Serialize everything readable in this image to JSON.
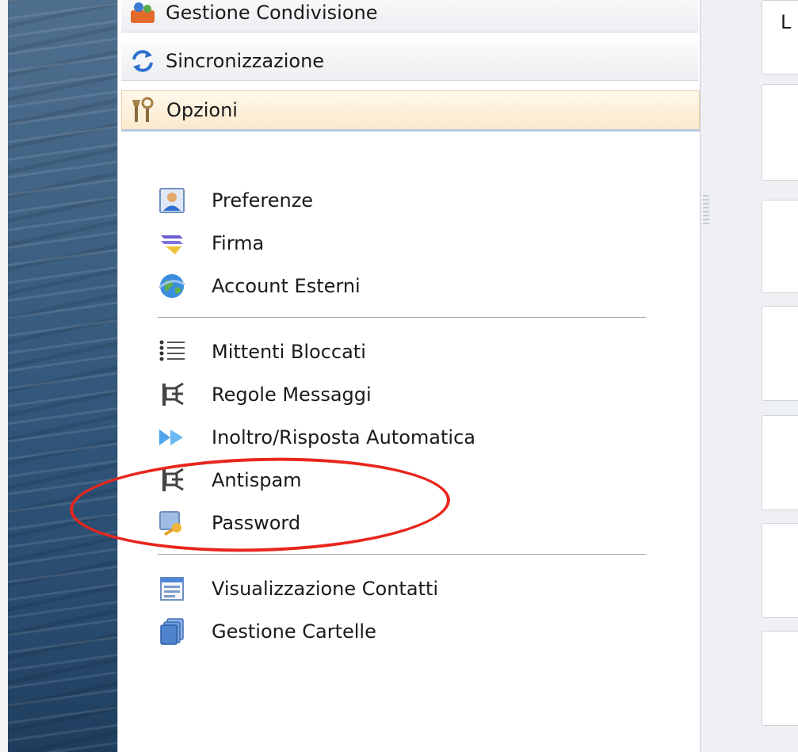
{
  "accordion": [
    {
      "label": "Gestione Condivisione",
      "icon": "share-management-icon"
    },
    {
      "label": "Sincronizzazione",
      "icon": "sync-icon"
    },
    {
      "label": "Opzioni",
      "icon": "tools-icon",
      "active": true
    }
  ],
  "menu": {
    "group1": [
      {
        "label": "Preferenze",
        "icon": "user-card-icon"
      },
      {
        "label": "Firma",
        "icon": "pen-icon"
      },
      {
        "label": "Account Esterni",
        "icon": "globe-icon"
      }
    ],
    "group2": [
      {
        "label": "Mittenti Bloccati",
        "icon": "list-icon"
      },
      {
        "label": "Regole Messaggi",
        "icon": "rules-icon"
      },
      {
        "label": "Inoltro/Risposta Automatica",
        "icon": "forward-icon"
      },
      {
        "label": "Antispam",
        "icon": "antispam-icon"
      },
      {
        "label": "Password",
        "icon": "key-icon"
      }
    ],
    "group3": [
      {
        "label": "Visualizzazione Contatti",
        "icon": "contacts-view-icon"
      },
      {
        "label": "Gestione Cartelle",
        "icon": "folders-icon"
      }
    ]
  },
  "right_panel": {
    "partial_text": "L"
  },
  "colors": {
    "highlight_ring": "#e8261d",
    "active_header": "#fbe9cc",
    "sea": "#2f5478"
  }
}
